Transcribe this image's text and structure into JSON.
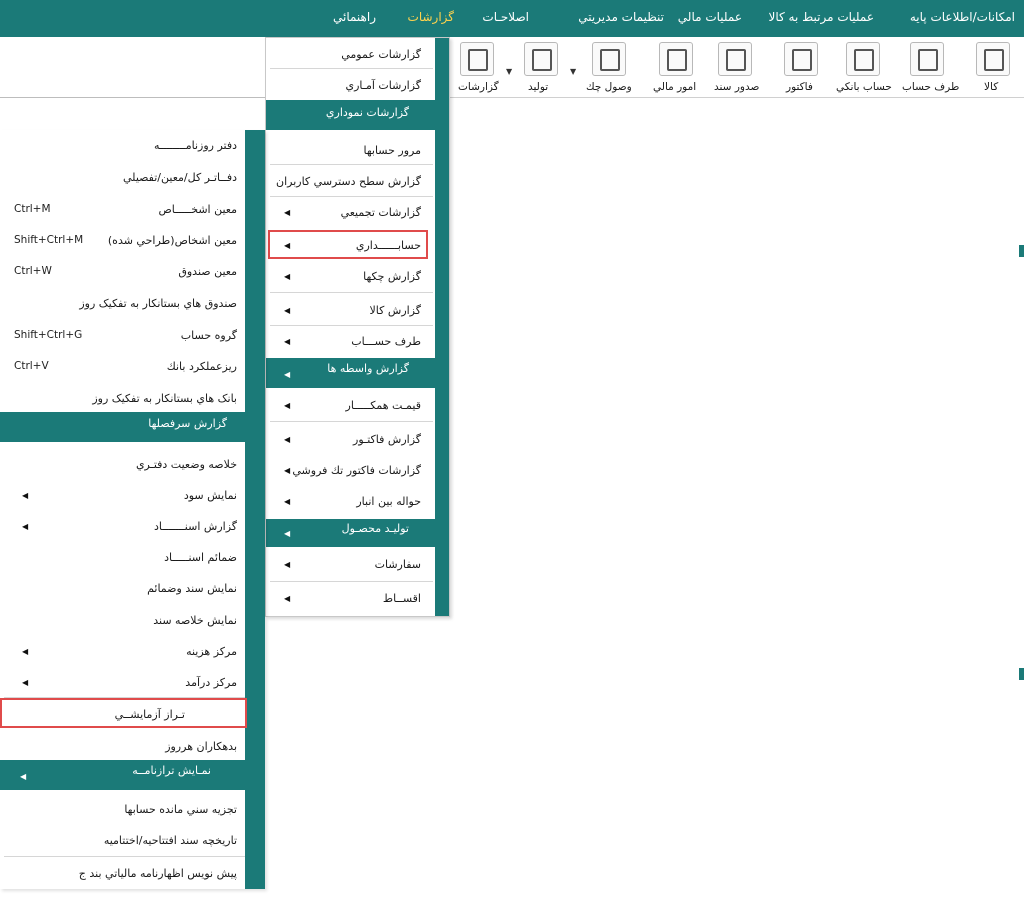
{
  "menubar": [
    {
      "label": "امکانات/اطلاعات پايه"
    },
    {
      "label": "عمليات مرتبط به کالا"
    },
    {
      "label": "عمليات مالي"
    },
    {
      "label": "تنظيمات مديريتي"
    },
    {
      "label": "اصلاحـات"
    },
    {
      "label": "گزارشات"
    },
    {
      "label": "راهنمائي"
    }
  ],
  "toolbar": [
    {
      "label": "کالا",
      "icon": "box-icon"
    },
    {
      "label": "طرف حساب",
      "icon": "person-icon"
    },
    {
      "label": "حساب بانکي",
      "icon": "bank-card-icon"
    },
    {
      "label": "فاکتور",
      "icon": "invoice-icon"
    },
    {
      "label": "صدور سند",
      "icon": "document-pen-icon"
    },
    {
      "label": "امور مالي",
      "icon": "finance-icon"
    },
    {
      "label": "وصول چك",
      "icon": "cheque-icon"
    },
    {
      "label": "توليد",
      "icon": "production-icon"
    },
    {
      "label": "گزارشات",
      "icon": "chart-report-icon"
    }
  ],
  "menu1": {
    "items": [
      {
        "label": "گزارشات عمومي",
        "kind": "item"
      },
      {
        "label": "گزارشات آمـاري",
        "kind": "item"
      },
      {
        "label": "گزارشات نموداري",
        "kind": "band"
      },
      {
        "label": "مرور حسابها",
        "kind": "item"
      },
      {
        "label": "گزارش سطح دسترسي کاربران",
        "kind": "item"
      },
      {
        "label": "گزارشات تجميعي",
        "kind": "item",
        "sub": true
      },
      {
        "label": "حسابــــــداري",
        "kind": "item",
        "sub": true,
        "highlight": true
      },
      {
        "label": "گزارش چکها",
        "kind": "item",
        "sub": true
      },
      {
        "label": "گزارش کالا",
        "kind": "item",
        "sub": true
      },
      {
        "label": "طرف حســـاب",
        "kind": "item",
        "sub": true
      },
      {
        "label": "گزارش واسطه ها",
        "kind": "band",
        "sub": true
      },
      {
        "label": "قيمـت همکـــــار",
        "kind": "item",
        "sub": true
      },
      {
        "label": "گزارش فاکتـور",
        "kind": "item",
        "sub": true
      },
      {
        "label": "گزارشات فاکتور تك فروشي",
        "kind": "item",
        "sub": true
      },
      {
        "label": "حواله بين انبار",
        "kind": "item",
        "sub": true
      },
      {
        "label": "توليـد محصـول",
        "kind": "band",
        "sub": true
      },
      {
        "label": "سفارشات",
        "kind": "item",
        "sub": true
      },
      {
        "label": "اقســاط",
        "kind": "item",
        "sub": true
      }
    ]
  },
  "menu2": {
    "items": [
      {
        "label": "دفتر روزنامــــــــه",
        "kind": "item"
      },
      {
        "label": "دفــاتـر کل/معين/تفصيلي",
        "kind": "item"
      },
      {
        "label": "معين اشخـــــاص",
        "kind": "item",
        "shortcut": "Ctrl+M"
      },
      {
        "label": "معين اشخاص(طراحي شده)",
        "kind": "item",
        "shortcut": "Shift+Ctrl+M"
      },
      {
        "label": "معين صندوق",
        "kind": "item",
        "shortcut": "Ctrl+W"
      },
      {
        "label": "صندوق هاي بستانکار به تفکيک روز",
        "kind": "item"
      },
      {
        "label": "گروه حساب",
        "kind": "item",
        "shortcut": "Shift+Ctrl+G"
      },
      {
        "label": "ريزعملکرد بانك",
        "kind": "item",
        "shortcut": "Ctrl+V"
      },
      {
        "label": "بانک هاي بستانکار به تفکيک روز",
        "kind": "item"
      },
      {
        "label": "گزارش سرفصلها",
        "kind": "band"
      },
      {
        "label": "خلاصه وضعيت دفتـري",
        "kind": "item"
      },
      {
        "label": "نمايش سود",
        "kind": "item",
        "sub": true
      },
      {
        "label": "گزارش   اسنـــــــاد",
        "kind": "item",
        "sub": true
      },
      {
        "label": "ضمائم اسنـــــاد",
        "kind": "item"
      },
      {
        "label": "نمايش سند وضمائم",
        "kind": "item"
      },
      {
        "label": "نمايش خلاصه سند",
        "kind": "item"
      },
      {
        "label": "مرکز هزينه",
        "kind": "item",
        "sub": true
      },
      {
        "label": "مرکز درآمد",
        "kind": "item",
        "sub": true
      },
      {
        "label": "تـراز آزمايشــي",
        "kind": "item",
        "highlight": true
      },
      {
        "label": "بدهكاران هرروز",
        "kind": "item"
      },
      {
        "label": "نمـايش ترازنامــه",
        "kind": "band",
        "sub": true
      },
      {
        "label": "تجزيه سني مانده حسابها",
        "kind": "item"
      },
      {
        "label": "تاريخچه سند افتتاحيه/اختتاميه",
        "kind": "item"
      },
      {
        "label": "پيش نويس اظهارنامه مالياتي بند ج",
        "kind": "item"
      }
    ]
  },
  "colors": {
    "teal": "#1b7a78",
    "highlight": "#e04b4b",
    "active_menu": "#ffd34d"
  }
}
